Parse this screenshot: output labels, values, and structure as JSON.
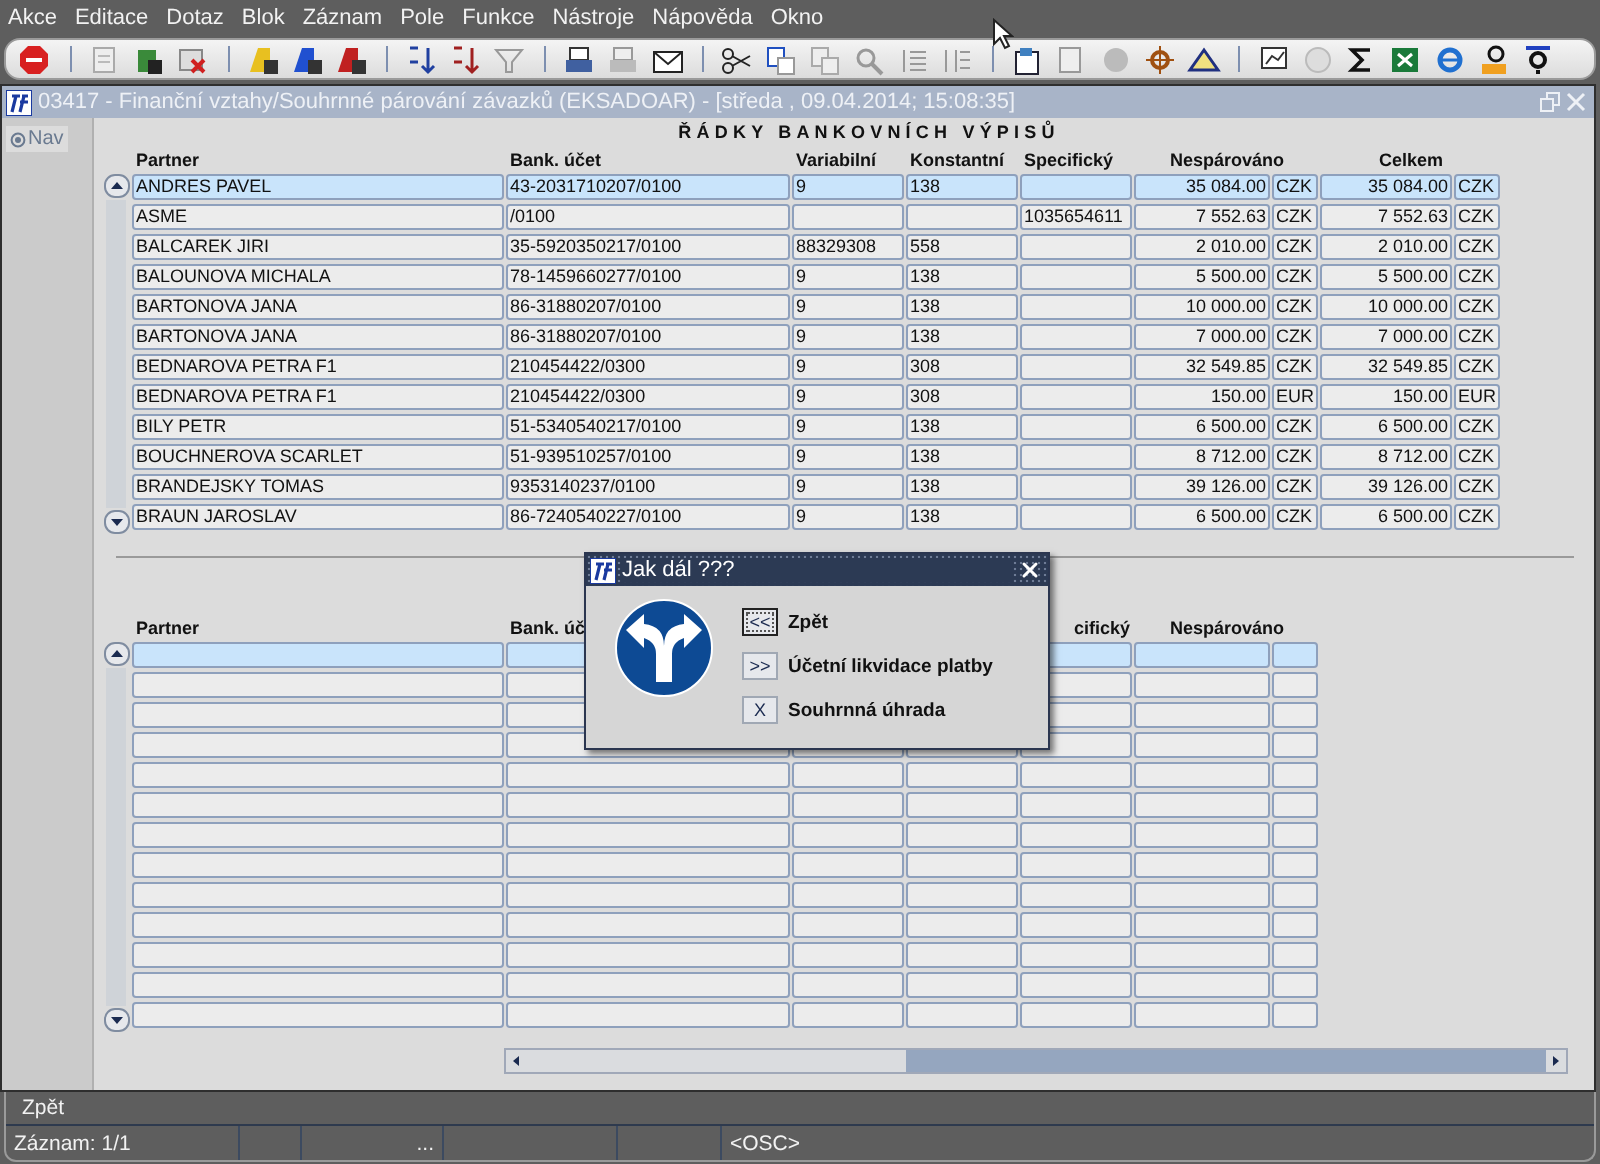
{
  "menu": [
    "Akce",
    "Editace",
    "Dotaz",
    "Blok",
    "Záznam",
    "Pole",
    "Funkce",
    "Nástroje",
    "Nápověda",
    "Okno"
  ],
  "window": {
    "title": "03417 - Finanční vztahy/Souhrnné párování závazků (EKSADOAR) - [středa , 09.04.2014; 15:08:35]"
  },
  "nav_button": "Nav",
  "heading": "ŘÁDKY BANKOVNÍCH VÝPISŮ",
  "table": {
    "columns": [
      "Partner",
      "Bank. účet",
      "Variabilní",
      "Konstantní",
      "Specifický",
      "Nespárováno",
      "Celkem"
    ],
    "rows": [
      {
        "selected": true,
        "partner": "ANDRES PAVEL",
        "account": "43-2031710207/0100",
        "variable": "9",
        "constant": "138",
        "unmatched": "35 084.00",
        "unmatched_currency": "CZK",
        "total": "35 084.00",
        "total_currency": "CZK"
      },
      {
        "selected": false,
        "partner": "ASME",
        "account": "/0100",
        "specific": "1035654611",
        "unmatched": "7 552.63",
        "unmatched_currency": "CZK",
        "total": "7 552.63",
        "total_currency": "CZK"
      },
      {
        "selected": false,
        "partner": "BALCAREK JIRI",
        "account": "35-5920350217/0100",
        "variable": "88329308",
        "constant": "558",
        "unmatched": "2 010.00",
        "unmatched_currency": "CZK",
        "total": "2 010.00",
        "total_currency": "CZK"
      },
      {
        "selected": false,
        "partner": "BALOUNOVA MICHALA",
        "account": "78-1459660277/0100",
        "variable": "9",
        "constant": "138",
        "unmatched": "5 500.00",
        "unmatched_currency": "CZK",
        "total": "5 500.00",
        "total_currency": "CZK"
      },
      {
        "selected": false,
        "partner": "BARTONOVA JANA",
        "account": "86-31880207/0100",
        "variable": "9",
        "constant": "138",
        "unmatched": "10 000.00",
        "unmatched_currency": "CZK",
        "total": "10 000.00",
        "total_currency": "CZK"
      },
      {
        "selected": false,
        "partner": "BARTONOVA JANA",
        "account": "86-31880207/0100",
        "variable": "9",
        "constant": "138",
        "unmatched": "7 000.00",
        "unmatched_currency": "CZK",
        "total": "7 000.00",
        "total_currency": "CZK"
      },
      {
        "selected": false,
        "partner": "BEDNAROVA PETRA F1",
        "account": "210454422/0300",
        "variable": "9",
        "constant": "308",
        "unmatched": "32 549.85",
        "unmatched_currency": "CZK",
        "total": "32 549.85",
        "total_currency": "CZK"
      },
      {
        "selected": false,
        "partner": "BEDNAROVA PETRA F1",
        "account": "210454422/0300",
        "variable": "9",
        "constant": "308",
        "unmatched": "150.00",
        "unmatched_currency": "EUR",
        "total": "150.00",
        "total_currency": "EUR"
      },
      {
        "selected": false,
        "partner": "BILY PETR",
        "account": "51-5340540217/0100",
        "variable": "9",
        "constant": "138",
        "unmatched": "6 500.00",
        "unmatched_currency": "CZK",
        "total": "6 500.00",
        "total_currency": "CZK"
      },
      {
        "selected": false,
        "partner": "BOUCHNEROVA SCARLET",
        "account": "51-939510257/0100",
        "variable": "9",
        "constant": "138",
        "unmatched": "8 712.00",
        "unmatched_currency": "CZK",
        "total": "8 712.00",
        "total_currency": "CZK"
      },
      {
        "selected": false,
        "partner": "BRANDEJSKY TOMAS",
        "account": "9353140237/0100",
        "variable": "9",
        "constant": "138",
        "unmatched": "39 126.00",
        "unmatched_currency": "CZK",
        "total": "39 126.00",
        "total_currency": "CZK"
      },
      {
        "selected": false,
        "partner": "BRAUN JAROSLAV",
        "account": "86-7240540227/0100",
        "variable": "9",
        "constant": "138",
        "unmatched": "6 500.00",
        "unmatched_currency": "CZK",
        "total": "6 500.00",
        "total_currency": "CZK"
      }
    ]
  },
  "table_2": {
    "columns": [
      "Partner",
      "Bank. úč",
      "cifický",
      "Nespárováno"
    ],
    "rows": [
      {
        "selected": true
      },
      {
        "selected": false
      },
      {
        "selected": false
      },
      {
        "selected": false
      },
      {
        "selected": false
      },
      {
        "selected": false
      },
      {
        "selected": false
      },
      {
        "selected": false
      },
      {
        "selected": false
      },
      {
        "selected": false
      },
      {
        "selected": false
      },
      {
        "selected": false
      },
      {
        "selected": false
      }
    ]
  },
  "dialog": {
    "title": "Jak dál ???",
    "options": [
      {
        "key": "<<",
        "label": "Zpět",
        "focused": true
      },
      {
        "key": ">>",
        "label": "Účetní likvidace platby",
        "focused": false
      },
      {
        "key": "X",
        "label": "Souhrnná úhrada",
        "focused": false
      }
    ]
  },
  "status_bar": {
    "message": "Zpět",
    "record": "Záznam: 1/1",
    "field_3": "...",
    "mode": "<OSC>"
  }
}
